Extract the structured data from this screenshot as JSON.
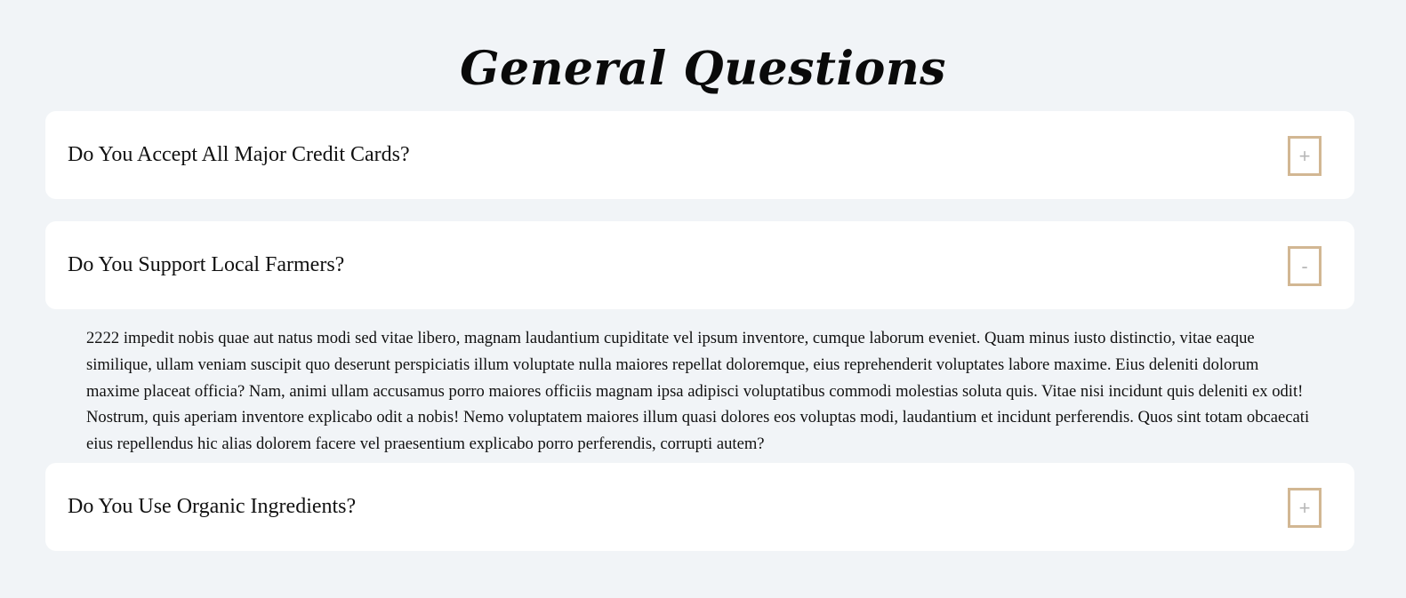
{
  "page": {
    "title": "General Questions",
    "colors": {
      "background": "#f1f4f7",
      "card": "#ffffff",
      "toggle_border": "#d2b793",
      "toggle_symbol": "#b7b7b7"
    }
  },
  "faq": {
    "items": [
      {
        "question": "Do You Accept All Major Credit Cards?",
        "toggle_symbol": "+",
        "expanded": false
      },
      {
        "question": "Do You Support Local Farmers?",
        "toggle_symbol": "-",
        "expanded": true,
        "answer": "2222 impedit nobis quae aut natus modi sed vitae libero, magnam laudantium cupiditate vel ipsum inventore, cumque laborum eveniet. Quam minus iusto distinctio, vitae eaque similique, ullam veniam suscipit quo deserunt perspiciatis illum voluptate nulla maiores repellat doloremque, eius reprehenderit voluptates labore maxime. Eius deleniti dolorum maxime placeat officia? Nam, animi ullam accusamus porro maiores officiis magnam ipsa adipisci voluptatibus commodi molestias soluta quis. Vitae nisi incidunt quis deleniti ex odit! Nostrum, quis aperiam inventore explicabo odit a nobis! Nemo voluptatem maiores illum quasi dolores eos voluptas modi, laudantium et incidunt perferendis. Quos sint totam obcaecati eius repellendus hic alias dolorem facere vel praesentium explicabo porro perferendis, corrupti autem?"
      },
      {
        "question": "Do You Use Organic Ingredients?",
        "toggle_symbol": "+",
        "expanded": false
      }
    ]
  }
}
